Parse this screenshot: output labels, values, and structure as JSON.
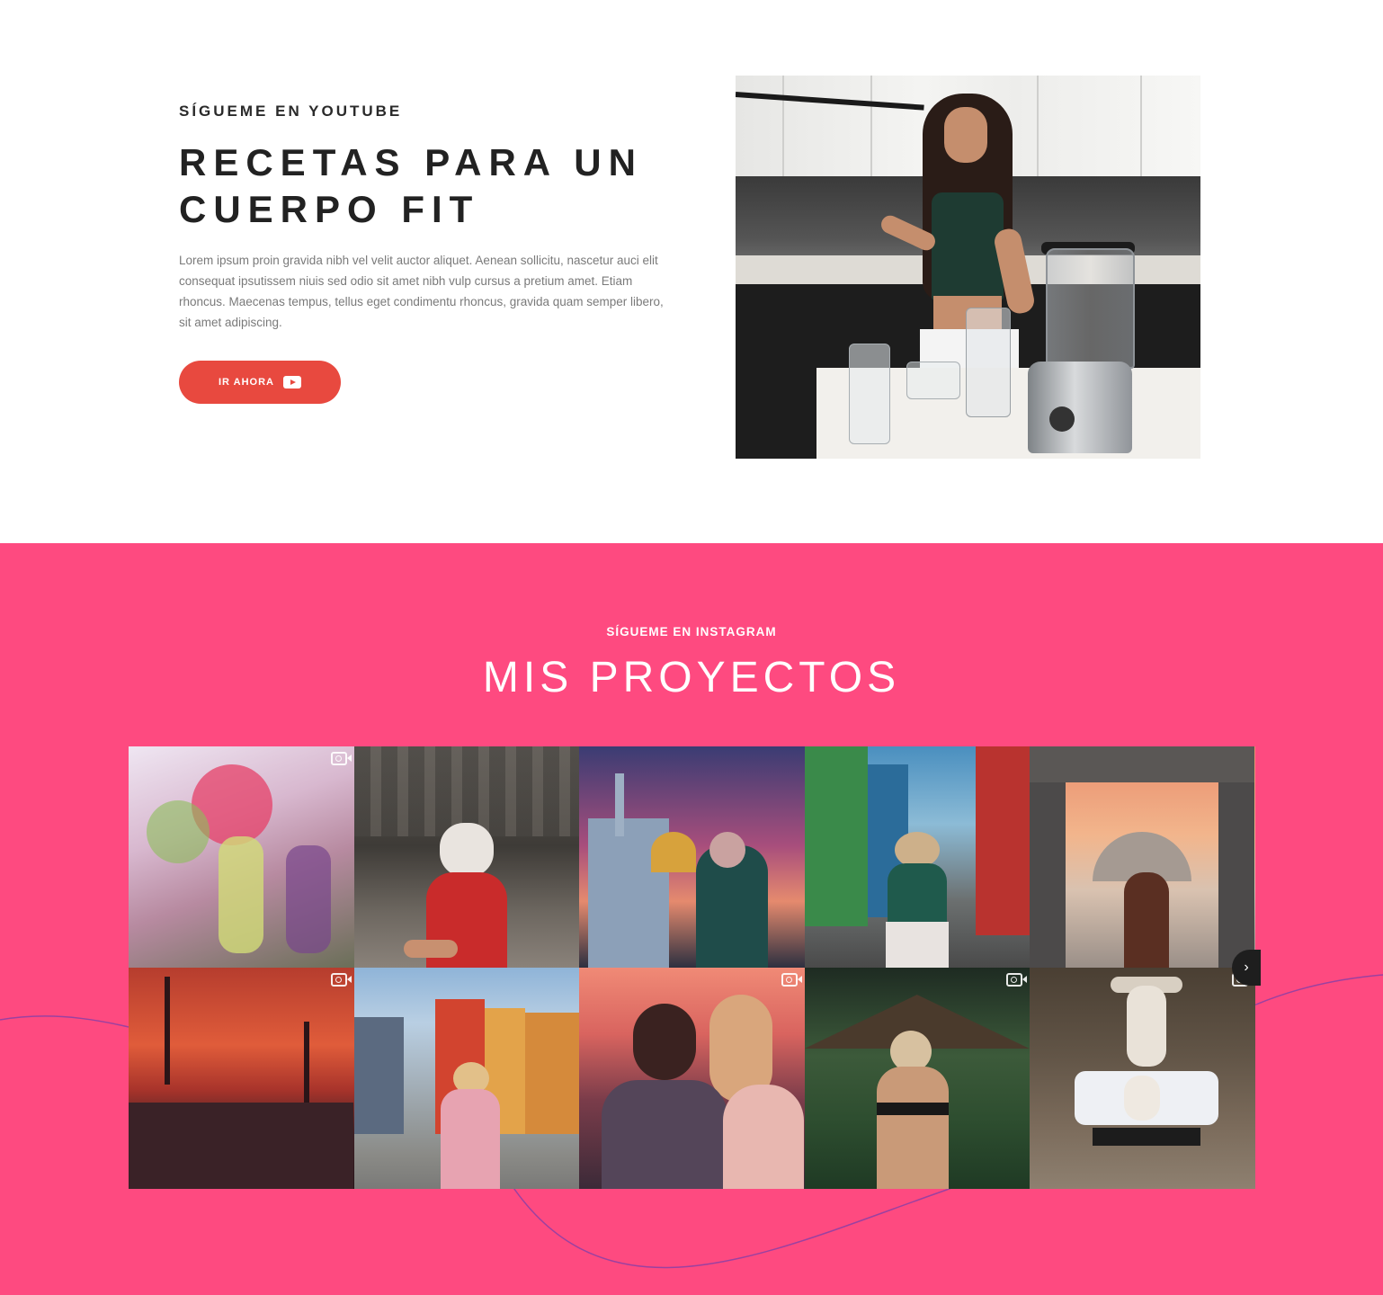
{
  "youtube": {
    "kicker": "SÍGUEME EN YOUTUBE",
    "title": "RECETAS PARA UN CUERPO FIT",
    "body": "Lorem ipsum proin gravida nibh vel velit auctor aliquet. Aenean sollicitu, nascetur auci elit consequat ipsutissem niuis sed odio sit amet nibh vulp cursus a pretium amet. Etiam rhoncus. Maecenas tempus, tellus eget condimentu rhoncus, gravida quam semper libero, sit amet adipiscing.",
    "button_label": "IR AHORA",
    "button_icon": "youtube-play-icon",
    "accent_color": "#e8493f"
  },
  "instagram": {
    "kicker": "SÍGUEME EN INSTAGRAM",
    "title": "MIS PROYECTOS",
    "background_color": "#fe4a80",
    "next_icon": "chevron-right-icon",
    "tiles": [
      {
        "scene": "holi-festival",
        "video": true
      },
      {
        "scene": "temple-mask",
        "video": false
      },
      {
        "scene": "mosque-sunset",
        "video": false
      },
      {
        "scene": "colorful-street",
        "video": false
      },
      {
        "scene": "arched-mosque",
        "video": false
      },
      {
        "scene": "city-sunset",
        "video": true
      },
      {
        "scene": "stockholm-houses",
        "video": false
      },
      {
        "scene": "couple-sunset",
        "video": true
      },
      {
        "scene": "tropical-resort",
        "video": true
      },
      {
        "scene": "bed-jump",
        "video": true
      }
    ]
  }
}
